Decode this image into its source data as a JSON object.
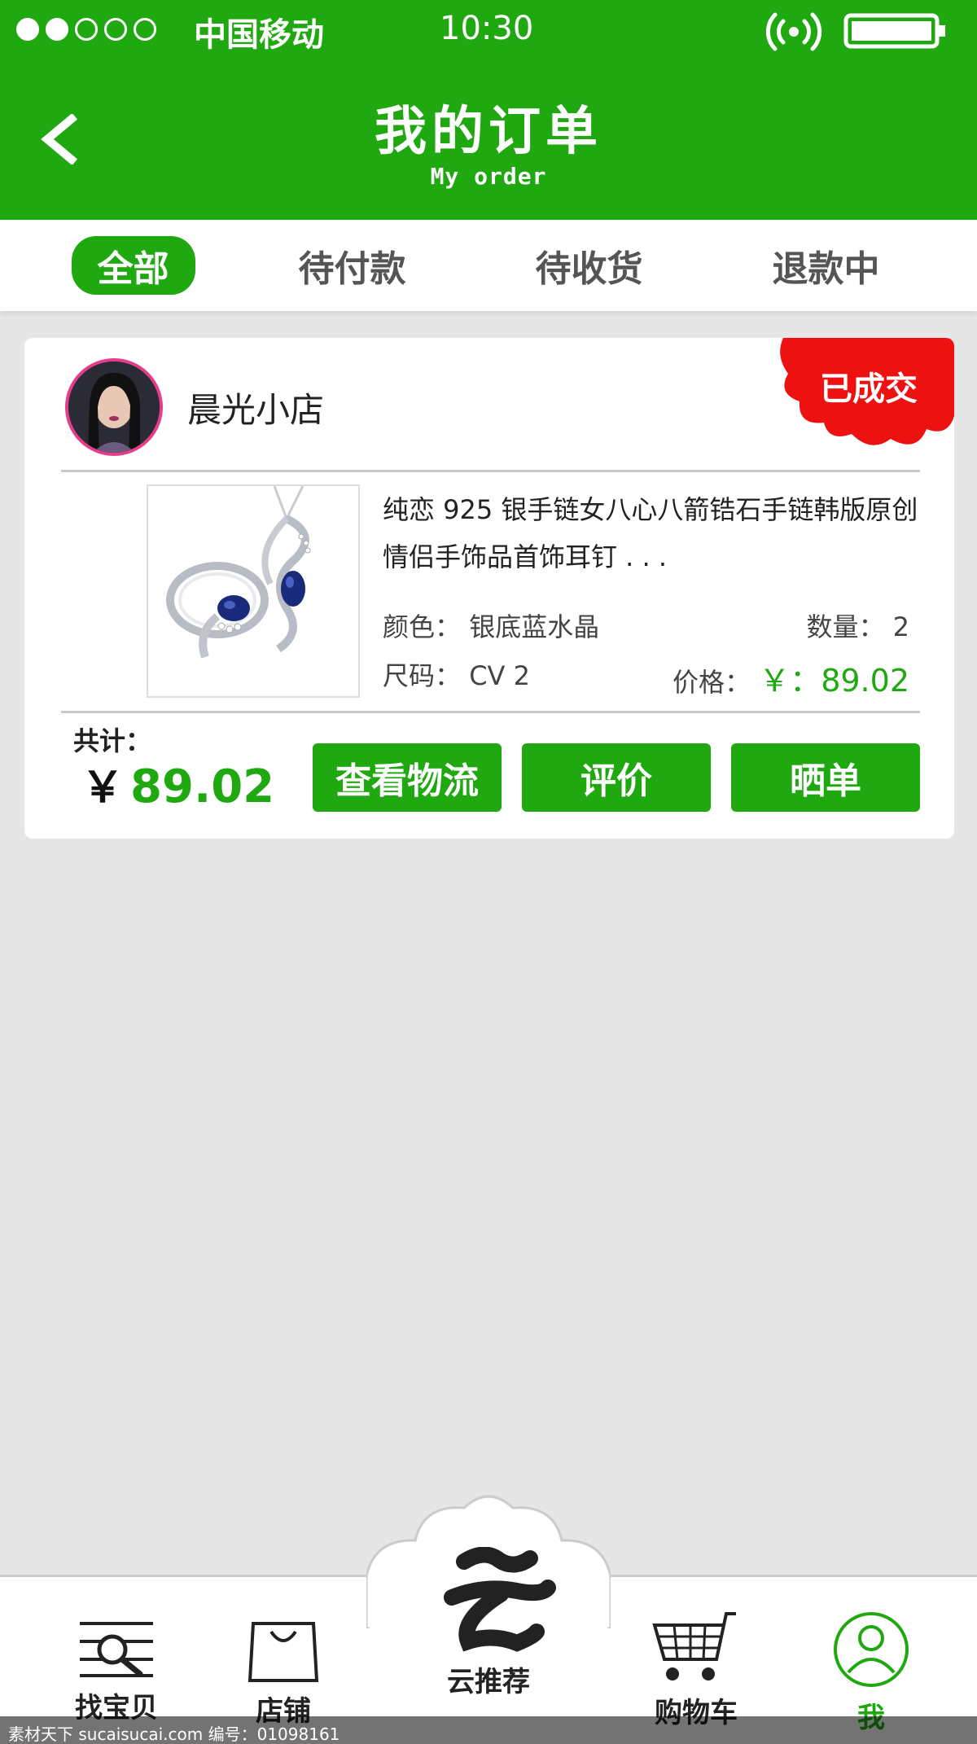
{
  "status_bar": {
    "carrier": "中国移动",
    "time": "10:30"
  },
  "nav": {
    "title": "我的订单",
    "subtitle": "My order"
  },
  "tabs": [
    {
      "label": "全部",
      "active": true
    },
    {
      "label": "待付款",
      "active": false
    },
    {
      "label": "待收货",
      "active": false
    },
    {
      "label": "退款中",
      "active": false
    }
  ],
  "order": {
    "shop_name": "晨光小店",
    "status": "已成交",
    "product_title": "纯恋 925 银手链女八心八箭锆石手链韩版原创情侣手饰品首饰耳钉 . . .",
    "color_label": "颜色：",
    "color_value": "银底蓝水晶",
    "size_label": "尺码：",
    "size_value": "CV 2",
    "qty_label": "数量：",
    "qty_value": "2",
    "price_label": "价格：",
    "price_value": "￥：89.02",
    "total_label": "共计：",
    "total_currency": "￥",
    "total_value": "89.02",
    "buttons": {
      "logistics": "查看物流",
      "review": "评价",
      "share": "晒单"
    }
  },
  "bottom_nav": {
    "items": [
      {
        "label": "找宝贝",
        "icon": "search-list-icon"
      },
      {
        "label": "店铺",
        "icon": "shopping-bag-icon"
      },
      {
        "label": "云推荐",
        "icon": "cloud-recommend-icon"
      },
      {
        "label": "购物车",
        "icon": "cart-icon"
      },
      {
        "label": "我",
        "icon": "user-icon"
      }
    ]
  },
  "watermark": "素材天下 sucaisucai.com  编号：01098161",
  "colors": {
    "brand_green": "#20a810",
    "badge_red": "#ee1111",
    "background": "#e6e6e6"
  }
}
